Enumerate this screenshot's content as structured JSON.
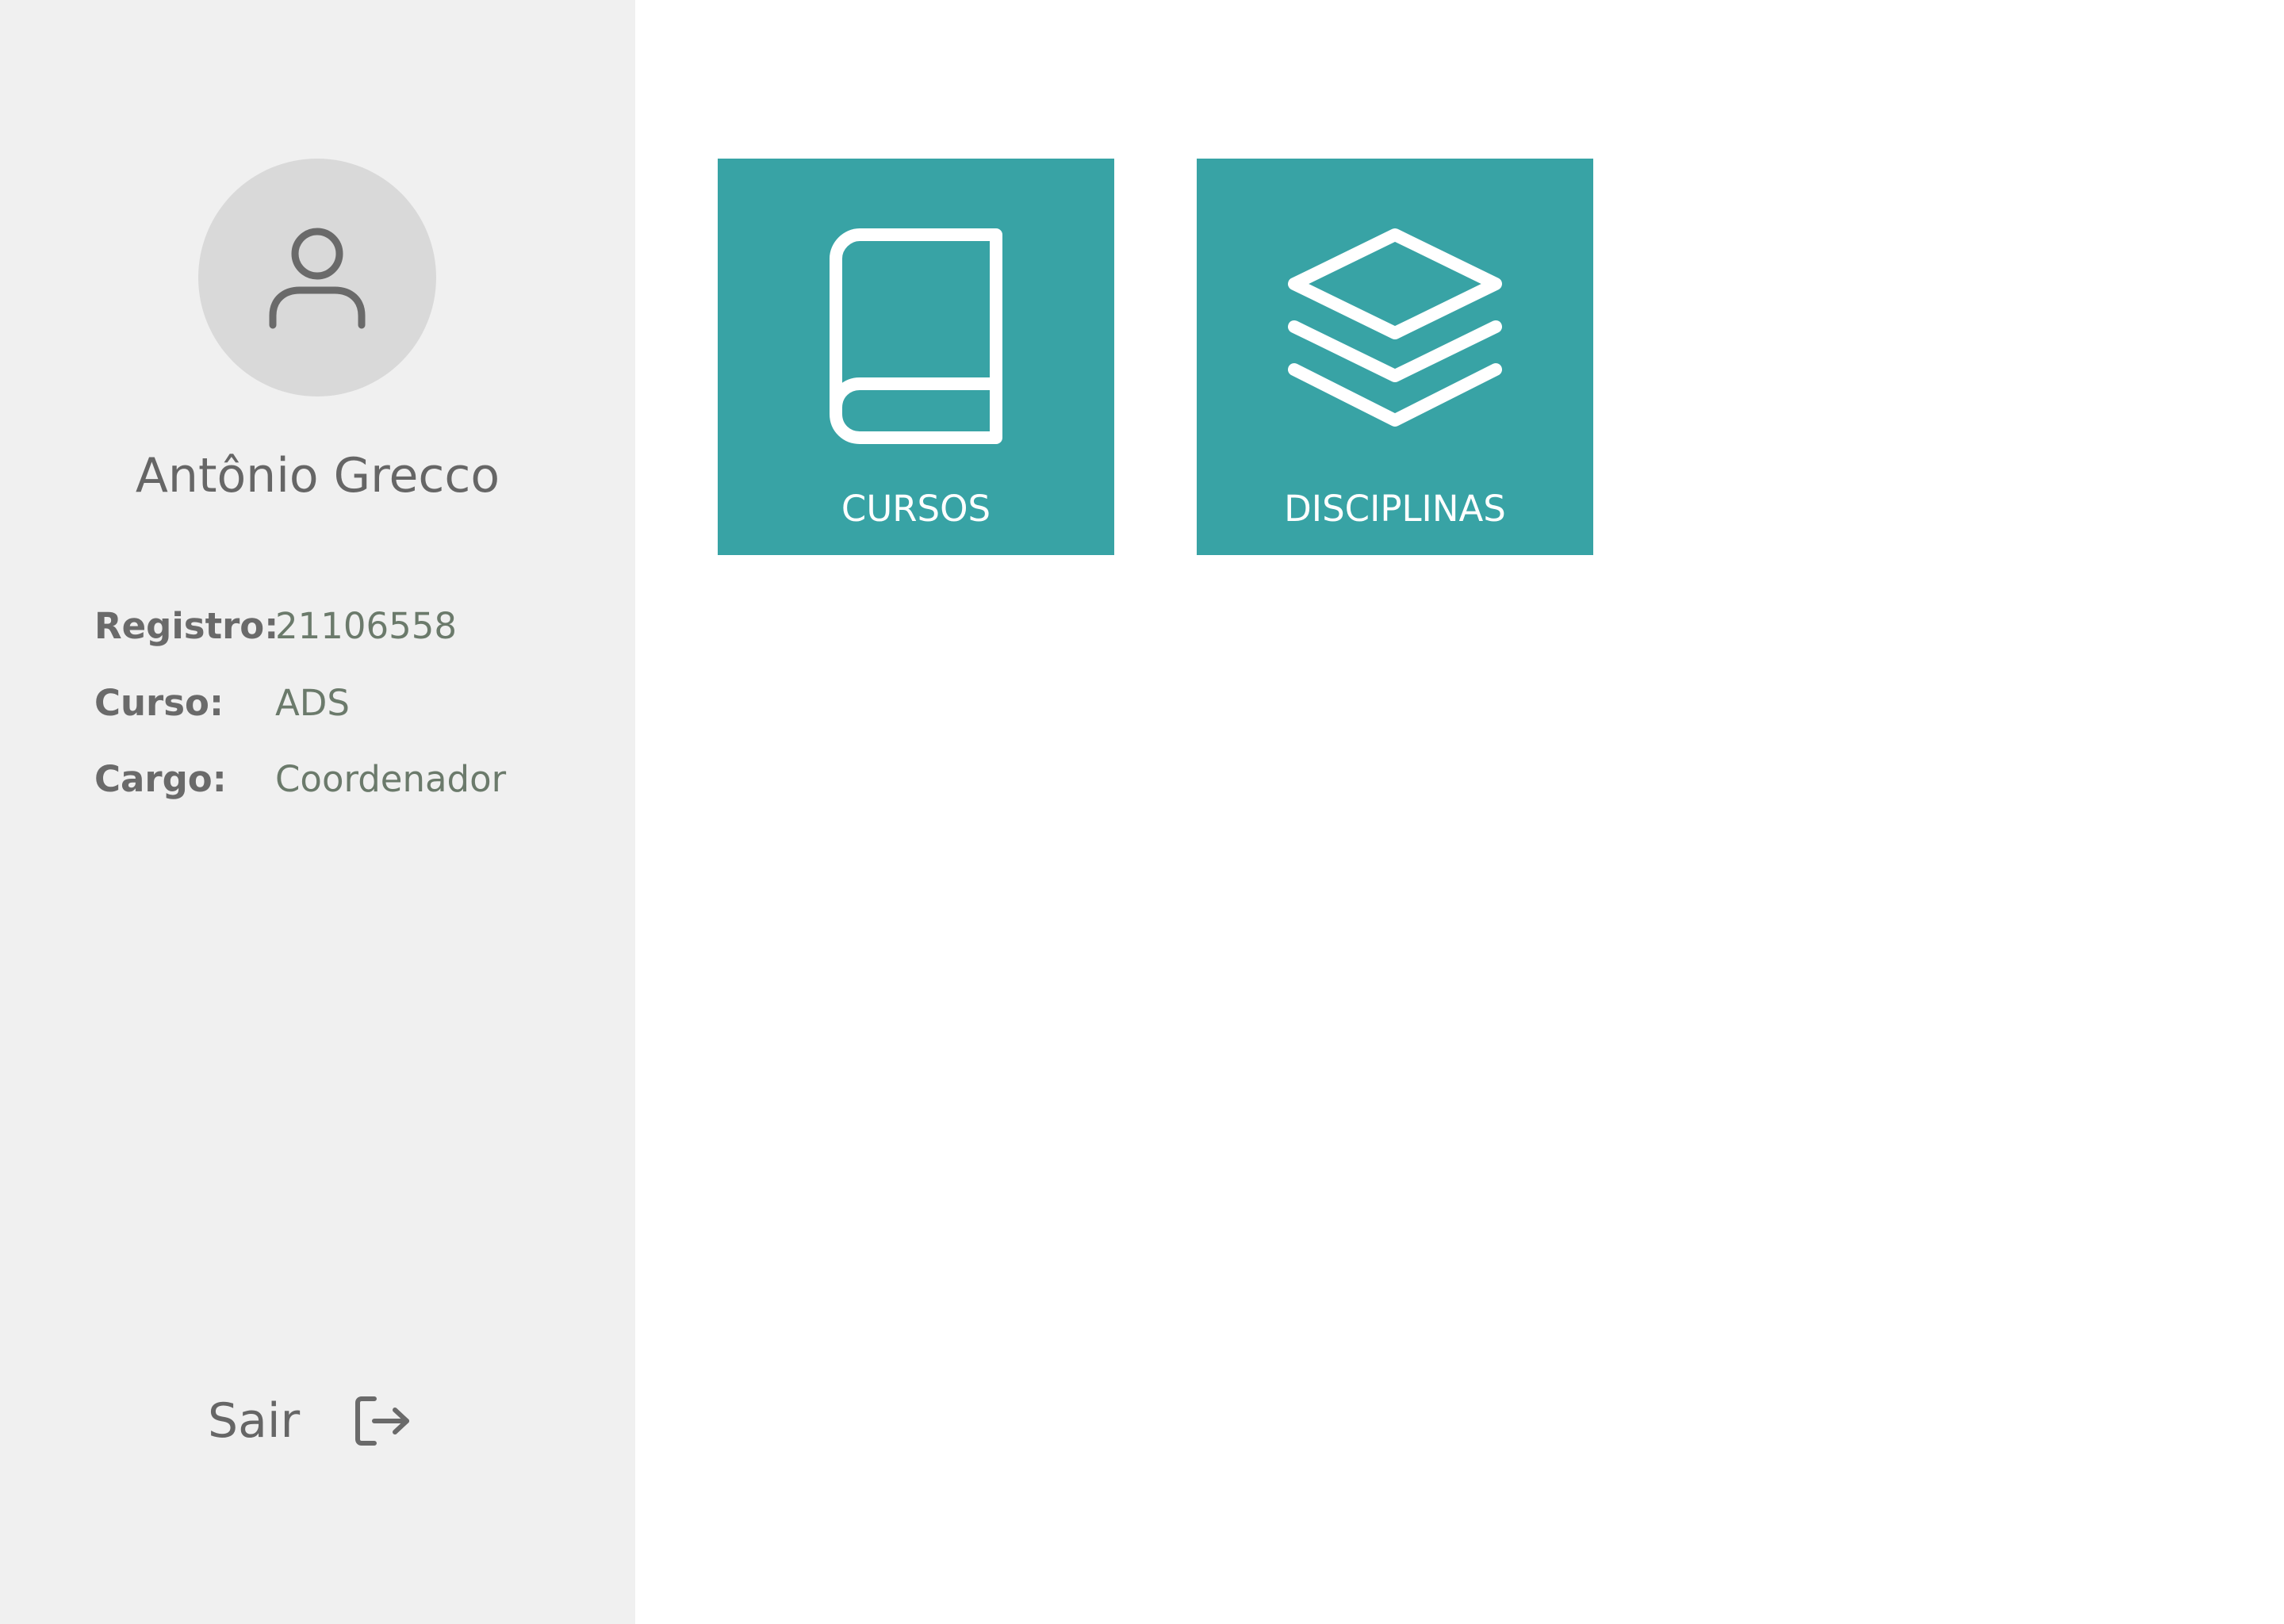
{
  "profile": {
    "name": "Antônio Grecco",
    "avatar_icon": "user-icon"
  },
  "info": [
    {
      "label": "Registro:",
      "value": "21106558"
    },
    {
      "label": "Curso:",
      "value": "ADS"
    },
    {
      "label": "Cargo:",
      "value": "Coordenador"
    }
  ],
  "logout": {
    "label": "Sair",
    "icon": "logout-icon"
  },
  "tiles": [
    {
      "label": "CURSOS",
      "icon": "book-icon"
    },
    {
      "label": "DISCIPLINAS",
      "icon": "layers-icon"
    }
  ],
  "colors": {
    "tile_background": "#38a3a5",
    "sidebar_background": "#f0f0f0",
    "avatar_background": "#d9d9d9",
    "text_gray": "#666666",
    "value_text": "#6b7a6b"
  }
}
